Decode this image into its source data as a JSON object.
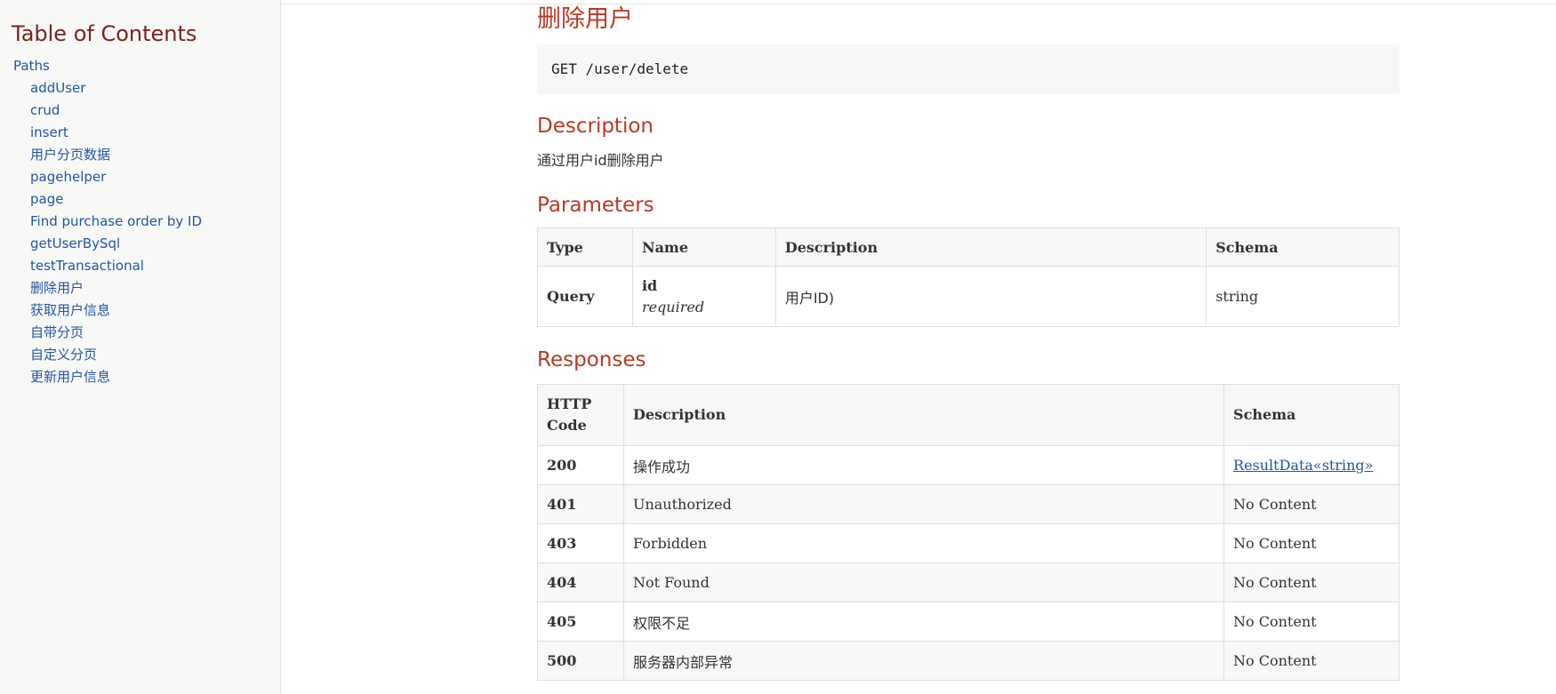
{
  "sidebar": {
    "title": "Table of Contents",
    "items": [
      {
        "label": "Paths",
        "level": 1
      },
      {
        "label": "addUser",
        "level": 2
      },
      {
        "label": "crud",
        "level": 2
      },
      {
        "label": "insert",
        "level": 2
      },
      {
        "label": "用户分页数据",
        "level": 2
      },
      {
        "label": "pagehelper",
        "level": 2
      },
      {
        "label": "page",
        "level": 2
      },
      {
        "label": "Find purchase order by ID",
        "level": 2
      },
      {
        "label": "getUserBySql",
        "level": 2
      },
      {
        "label": "testTransactional",
        "level": 2
      },
      {
        "label": "删除用户",
        "level": 2
      },
      {
        "label": "获取用户信息",
        "level": 2
      },
      {
        "label": "自带分页",
        "level": 2
      },
      {
        "label": "自定义分页",
        "level": 2
      },
      {
        "label": "更新用户信息",
        "level": 2
      }
    ]
  },
  "operation": {
    "title": "删除用户",
    "endpoint": "GET /user/delete",
    "description_heading": "Description",
    "description": "通过用户id删除用户",
    "parameters_heading": "Parameters",
    "parameters": {
      "headers": [
        "Type",
        "Name",
        "Description",
        "Schema"
      ],
      "rows": [
        {
          "type": "Query",
          "name": "id",
          "required": "required",
          "description": "用户ID)",
          "schema": "string"
        }
      ]
    },
    "responses_heading": "Responses",
    "responses": {
      "headers": [
        "HTTP Code",
        "Description",
        "Schema"
      ],
      "rows": [
        {
          "code": "200",
          "description": "操作成功",
          "schema": "ResultData«string»",
          "schema_is_link": true
        },
        {
          "code": "401",
          "description": "Unauthorized",
          "schema": "No Content",
          "schema_is_link": false
        },
        {
          "code": "403",
          "description": "Forbidden",
          "schema": "No Content",
          "schema_is_link": false
        },
        {
          "code": "404",
          "description": "Not Found",
          "schema": "No Content",
          "schema_is_link": false
        },
        {
          "code": "405",
          "description": "权限不足",
          "schema": "No Content",
          "schema_is_link": false
        },
        {
          "code": "500",
          "description": "服务器内部异常",
          "schema": "No Content",
          "schema_is_link": false
        }
      ]
    }
  },
  "colors": {
    "heading": "#ba3925",
    "toc_title": "#7a2518",
    "link": "#2156a5",
    "sidebar_bg": "#f8f8f7"
  }
}
